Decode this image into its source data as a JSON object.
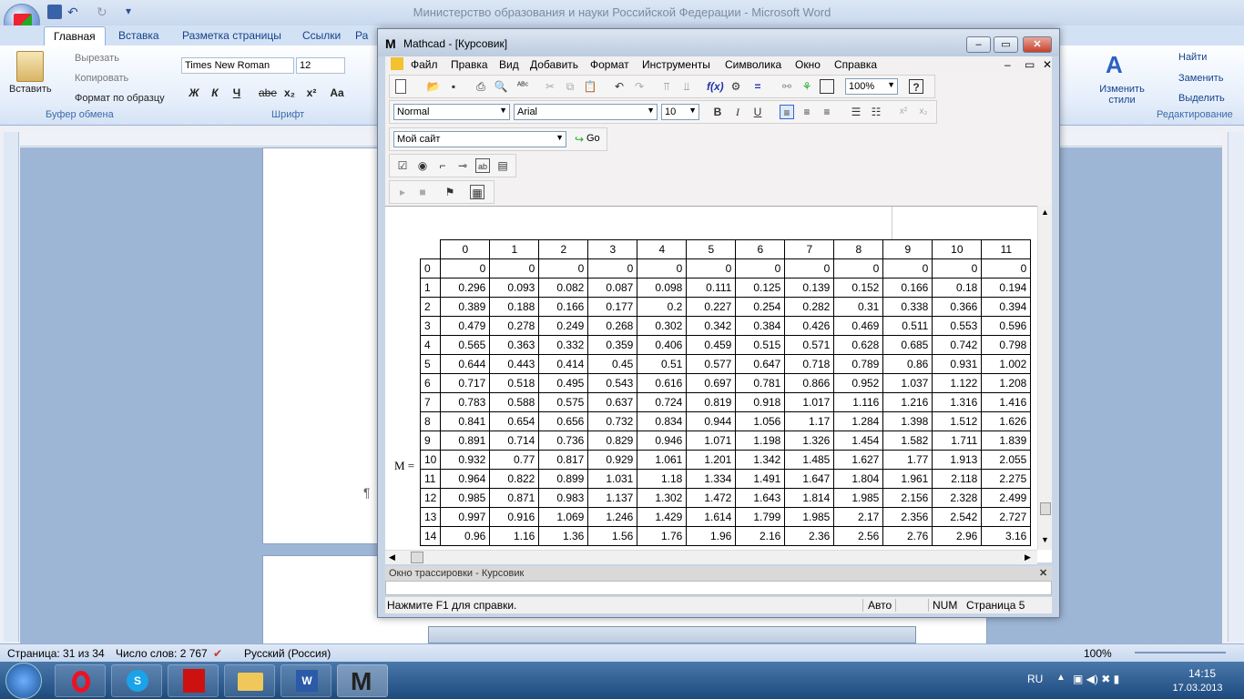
{
  "word": {
    "title": "Министерство образования и науки Российской Федерации - Microsoft Word",
    "tabs": [
      "Главная",
      "Вставка",
      "Разметка страницы",
      "Ссылки",
      "Ра"
    ],
    "clipboard": {
      "paste": "Вставить",
      "cut": "Вырезать",
      "copy": "Копировать",
      "format_painter": "Формат по образцу",
      "group": "Буфер обмена"
    },
    "font": {
      "name": "Times New Roman",
      "size": "12",
      "group": "Шрифт",
      "bold": "Ж",
      "italic": "К",
      "underline": "Ч",
      "strike": "abe",
      "sub": "x₂",
      "sup": "x²",
      "case": "Aa"
    },
    "styles": {
      "change": "Изменить стили"
    },
    "editing": {
      "find": "Найти",
      "replace": "Заменить",
      "select": "Выделить",
      "group": "Редактирование"
    },
    "pilcrow": "¶",
    "status": {
      "page": "Страница: 31 из 34",
      "words": "Число слов: 2 767",
      "lang": "Русский (Россия)",
      "zoom": "100%"
    }
  },
  "mathcad": {
    "title": "Mathcad - [Курсовик]",
    "menu": [
      "Файл",
      "Правка",
      "Вид",
      "Добавить",
      "Формат",
      "Инструменты",
      "Символика",
      "Окно",
      "Справка"
    ],
    "zoom": "100%",
    "style": "Normal",
    "font": "Arial",
    "size": "10",
    "site": "Мой сайт",
    "go": "Go",
    "matrix_label": "M =",
    "col_headers": [
      "0",
      "1",
      "2",
      "3",
      "4",
      "5",
      "6",
      "7",
      "8",
      "9",
      "10",
      "11"
    ],
    "rows": [
      {
        "i": "0",
        "v": [
          "0",
          "0",
          "0",
          "0",
          "0",
          "0",
          "0",
          "0",
          "0",
          "0",
          "0",
          "0"
        ]
      },
      {
        "i": "1",
        "v": [
          "0.296",
          "0.093",
          "0.082",
          "0.087",
          "0.098",
          "0.111",
          "0.125",
          "0.139",
          "0.152",
          "0.166",
          "0.18",
          "0.194"
        ]
      },
      {
        "i": "2",
        "v": [
          "0.389",
          "0.188",
          "0.166",
          "0.177",
          "0.2",
          "0.227",
          "0.254",
          "0.282",
          "0.31",
          "0.338",
          "0.366",
          "0.394"
        ]
      },
      {
        "i": "3",
        "v": [
          "0.479",
          "0.278",
          "0.249",
          "0.268",
          "0.302",
          "0.342",
          "0.384",
          "0.426",
          "0.469",
          "0.511",
          "0.553",
          "0.596"
        ]
      },
      {
        "i": "4",
        "v": [
          "0.565",
          "0.363",
          "0.332",
          "0.359",
          "0.406",
          "0.459",
          "0.515",
          "0.571",
          "0.628",
          "0.685",
          "0.742",
          "0.798"
        ]
      },
      {
        "i": "5",
        "v": [
          "0.644",
          "0.443",
          "0.414",
          "0.45",
          "0.51",
          "0.577",
          "0.647",
          "0.718",
          "0.789",
          "0.86",
          "0.931",
          "1.002"
        ]
      },
      {
        "i": "6",
        "v": [
          "0.717",
          "0.518",
          "0.495",
          "0.543",
          "0.616",
          "0.697",
          "0.781",
          "0.866",
          "0.952",
          "1.037",
          "1.122",
          "1.208"
        ]
      },
      {
        "i": "7",
        "v": [
          "0.783",
          "0.588",
          "0.575",
          "0.637",
          "0.724",
          "0.819",
          "0.918",
          "1.017",
          "1.116",
          "1.216",
          "1.316",
          "1.416"
        ]
      },
      {
        "i": "8",
        "v": [
          "0.841",
          "0.654",
          "0.656",
          "0.732",
          "0.834",
          "0.944",
          "1.056",
          "1.17",
          "1.284",
          "1.398",
          "1.512",
          "1.626"
        ]
      },
      {
        "i": "9",
        "v": [
          "0.891",
          "0.714",
          "0.736",
          "0.829",
          "0.946",
          "1.071",
          "1.198",
          "1.326",
          "1.454",
          "1.582",
          "1.711",
          "1.839"
        ]
      },
      {
        "i": "10",
        "v": [
          "0.932",
          "0.77",
          "0.817",
          "0.929",
          "1.061",
          "1.201",
          "1.342",
          "1.485",
          "1.627",
          "1.77",
          "1.913",
          "2.055"
        ]
      },
      {
        "i": "11",
        "v": [
          "0.964",
          "0.822",
          "0.899",
          "1.031",
          "1.18",
          "1.334",
          "1.491",
          "1.647",
          "1.804",
          "1.961",
          "2.118",
          "2.275"
        ]
      },
      {
        "i": "12",
        "v": [
          "0.985",
          "0.871",
          "0.983",
          "1.137",
          "1.302",
          "1.472",
          "1.643",
          "1.814",
          "1.985",
          "2.156",
          "2.328",
          "2.499"
        ]
      },
      {
        "i": "13",
        "v": [
          "0.997",
          "0.916",
          "1.069",
          "1.246",
          "1.429",
          "1.614",
          "1.799",
          "1.985",
          "2.17",
          "2.356",
          "2.542",
          "2.727"
        ]
      },
      {
        "i": "14",
        "v": [
          "0.96",
          "1.16",
          "1.36",
          "1.56",
          "1.76",
          "1.96",
          "2.16",
          "2.36",
          "2.56",
          "2.76",
          "2.96",
          "3.16"
        ]
      }
    ],
    "trace": "Окно трассировки - Курсовик",
    "status": {
      "help": "Нажмите F1 для справки.",
      "auto": "Авто",
      "num": "NUM",
      "page": "Страница 5"
    }
  },
  "taskbar": {
    "lang": "RU",
    "time": "14:15",
    "date": "17.03.2013"
  }
}
